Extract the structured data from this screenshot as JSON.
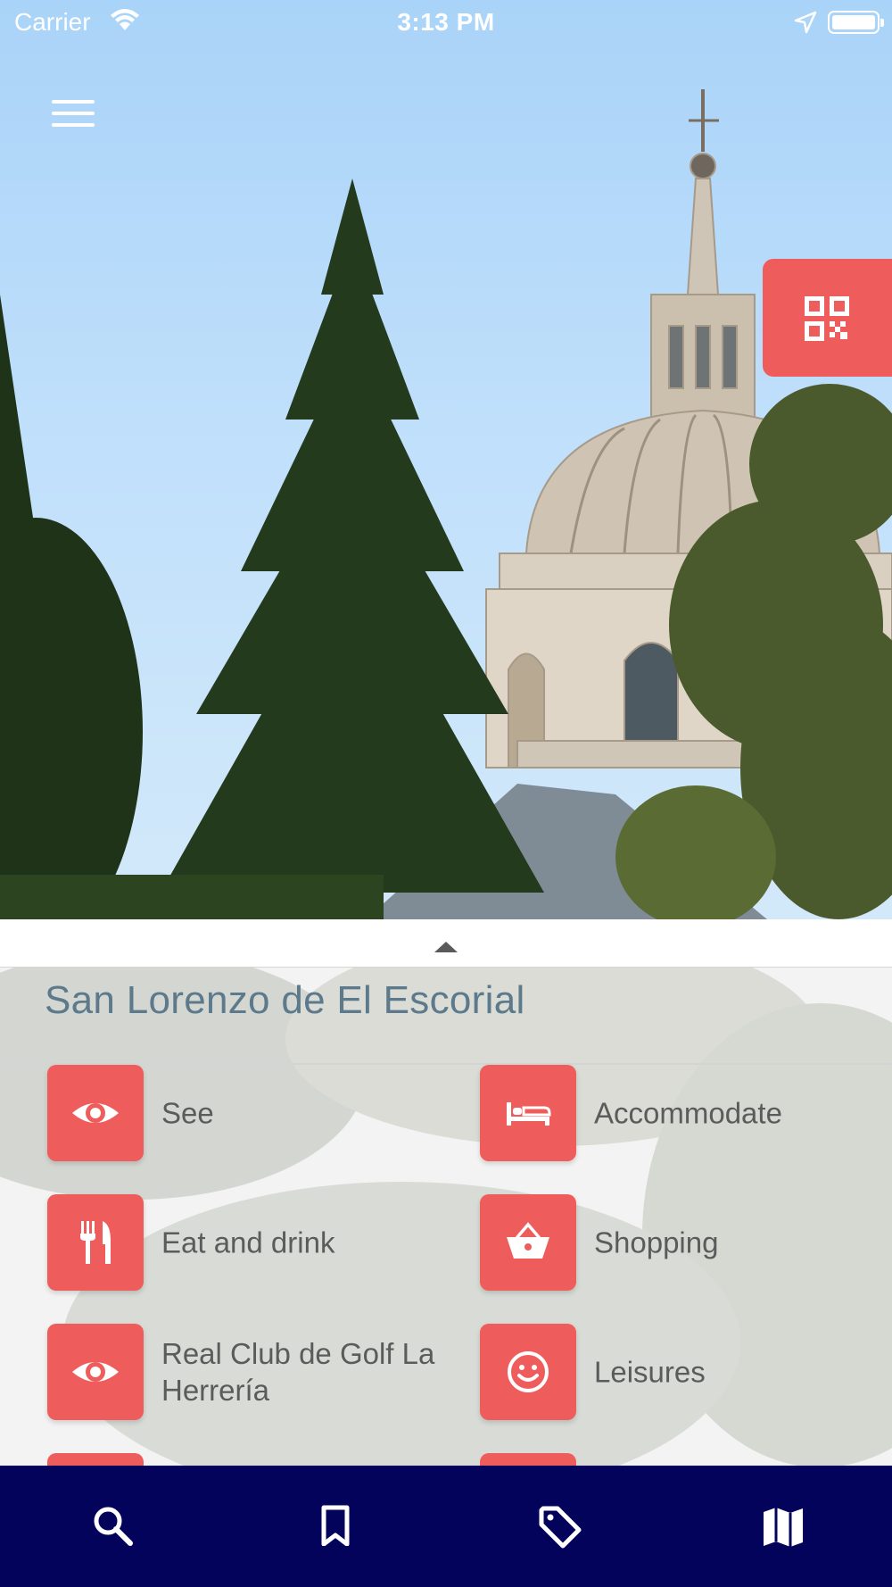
{
  "status_bar": {
    "carrier": "Carrier",
    "time": "3:13 PM",
    "icons": [
      "wifi-icon",
      "location-arrow-icon",
      "battery-icon"
    ]
  },
  "header": {
    "menu_icon": "hamburger-menu-icon",
    "qr_icon": "qr-code-icon",
    "accent_color": "#ef5c5c"
  },
  "sheet": {
    "handle_icon": "caret-up-icon",
    "title": "San Lorenzo de El Escorial",
    "categories": [
      {
        "label": "See",
        "icon": "eye-icon"
      },
      {
        "label": "Accommodate",
        "icon": "bed-icon"
      },
      {
        "label": "Eat and drink",
        "icon": "fork-knife-icon"
      },
      {
        "label": "Shopping",
        "icon": "shopping-basket-icon"
      },
      {
        "label": "Real Club de Golf La Herrería",
        "icon": "eye-icon"
      },
      {
        "label": "Leisures",
        "icon": "smiley-icon"
      }
    ]
  },
  "tab_bar": {
    "background": "#03035c",
    "tabs": [
      {
        "icon": "search-icon"
      },
      {
        "icon": "bookmark-icon"
      },
      {
        "icon": "tag-icon"
      },
      {
        "icon": "map-icon"
      }
    ]
  }
}
